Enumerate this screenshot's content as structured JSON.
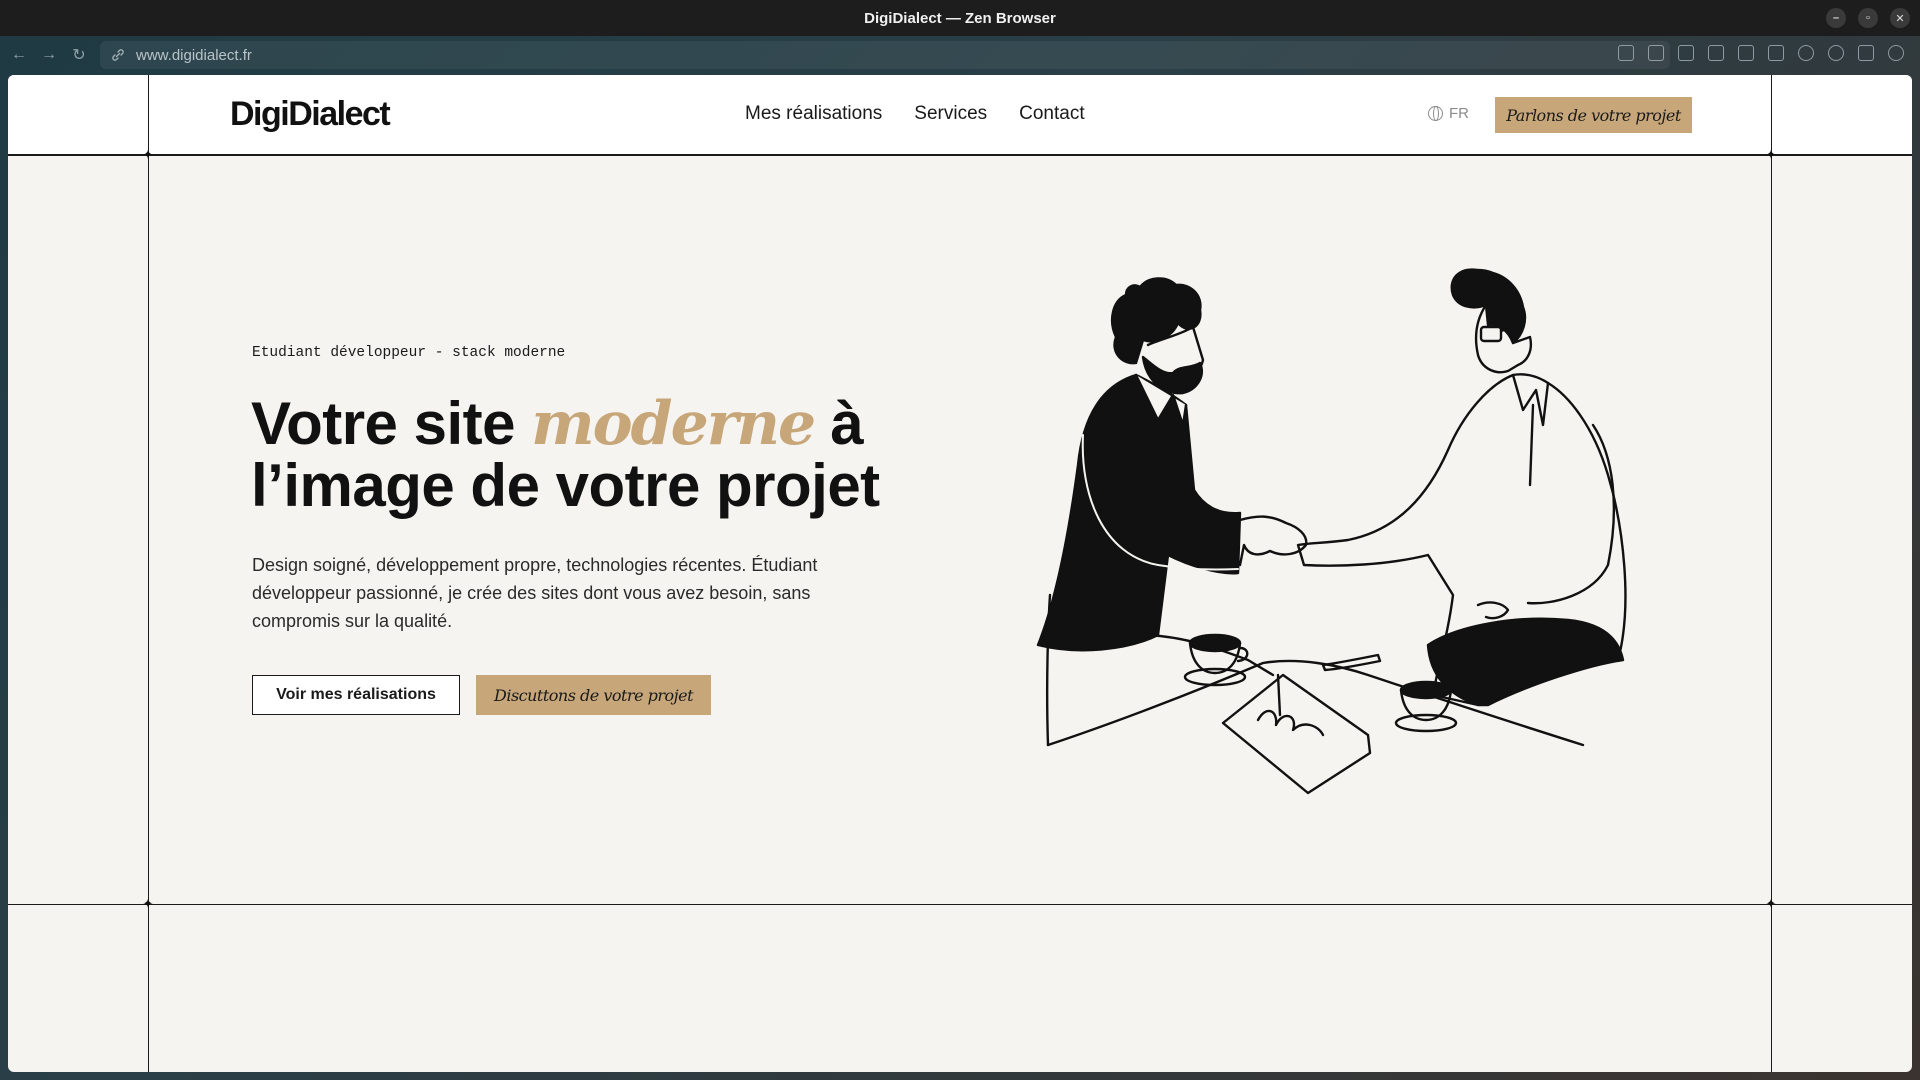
{
  "window": {
    "title": "DigiDialect — Zen Browser",
    "controls": [
      "–",
      "▫",
      "✕"
    ]
  },
  "browser": {
    "url": "www.digidialect.fr",
    "back_glyph": "←",
    "forward_glyph": "→",
    "reload_glyph": "↻",
    "url_icon": "link-icon"
  },
  "header": {
    "logo": "DigiDialect",
    "nav": [
      "Mes réalisations",
      "Services",
      "Contact"
    ],
    "lang": "FR",
    "cta": "Parlons de votre projet"
  },
  "hero": {
    "eyebrow": "Etudiant développeur - stack moderne",
    "headline_pre": "Votre site ",
    "headline_accent": "moderne",
    "headline_post": " à l’image de votre projet",
    "subtext": "Design soigné, développement propre, technologies récentes. Étudiant développeur passionné, je crée des sites dont vous avez besoin, sans compromis sur la qualité.",
    "btn_primary": "Voir mes réalisations",
    "btn_secondary": "Discuttons de votre projet"
  },
  "colors": {
    "accent": "#c7a679",
    "page_bg": "#f6f4f0",
    "ink": "#111111"
  }
}
